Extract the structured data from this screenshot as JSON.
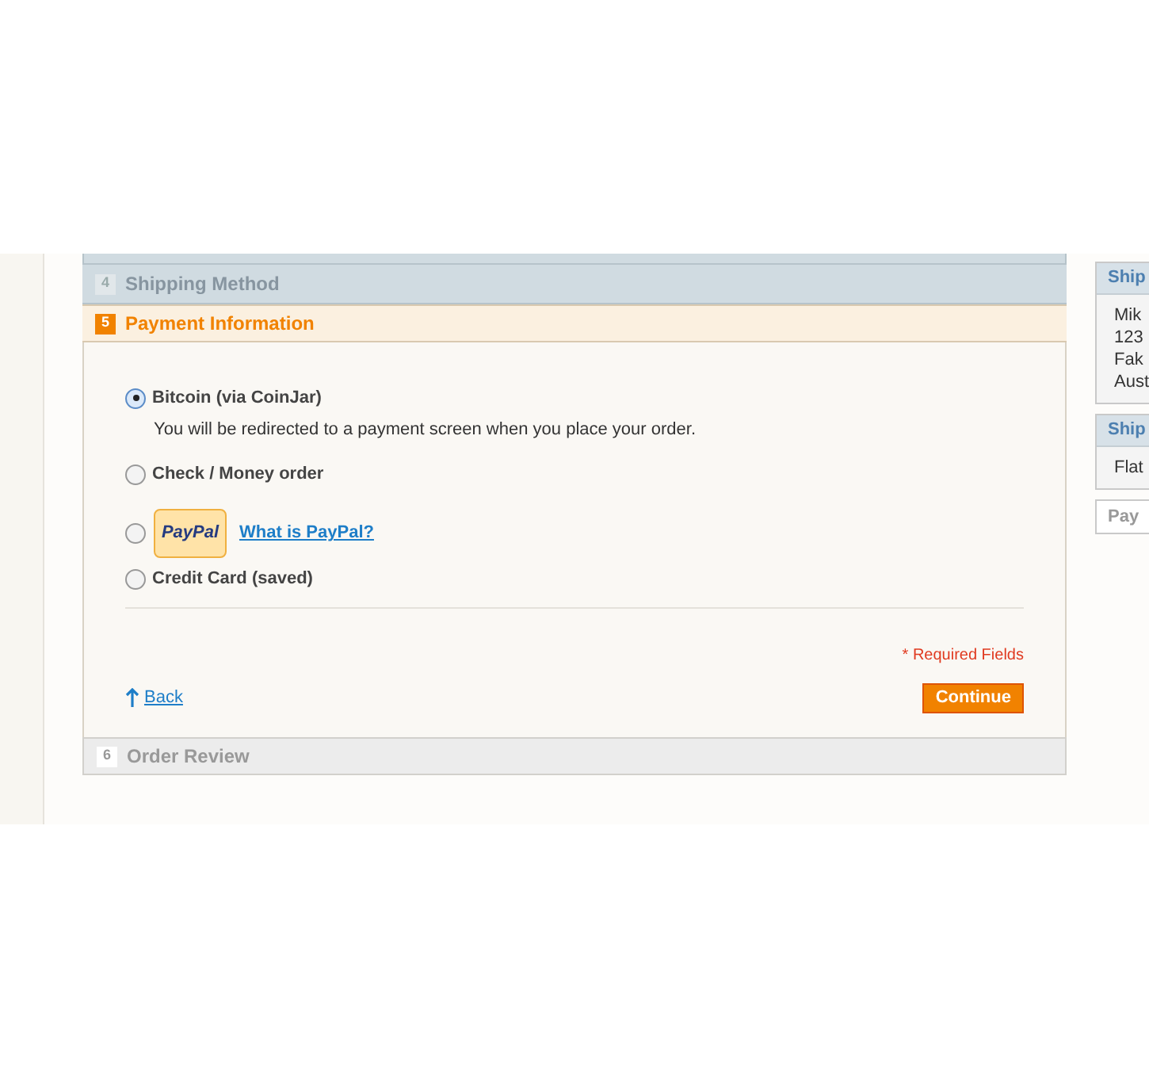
{
  "steps": [
    {
      "number": "4",
      "title": "Shipping Method",
      "kind": "done"
    },
    {
      "number": "5",
      "title": "Payment Information",
      "kind": "active"
    }
  ],
  "payment_methods": [
    {
      "kind": "text",
      "label": "Bitcoin (via CoinJar)",
      "selected": true,
      "description": "You will be redirected to a payment screen when you place your order."
    },
    {
      "kind": "text",
      "label": "Check / Money order",
      "selected": false
    },
    {
      "kind": "paypal",
      "logo": "PayPal",
      "link": "What is PayPal?",
      "selected": false
    },
    {
      "kind": "text",
      "label": "Credit Card (saved)",
      "selected": false
    }
  ],
  "required_note": "* Required Fields",
  "back_link": "Back",
  "continue_button": "Continue",
  "next_steps": [
    {
      "number": "6",
      "title": "Order Review"
    }
  ],
  "sidebar": [
    {
      "title": "Ship",
      "lines": [
        "Mik",
        "123",
        "Fak",
        "Aust"
      ]
    },
    {
      "title": "Ship",
      "lines": [
        "Flat"
      ]
    },
    {
      "title": "Pay"
    }
  ]
}
